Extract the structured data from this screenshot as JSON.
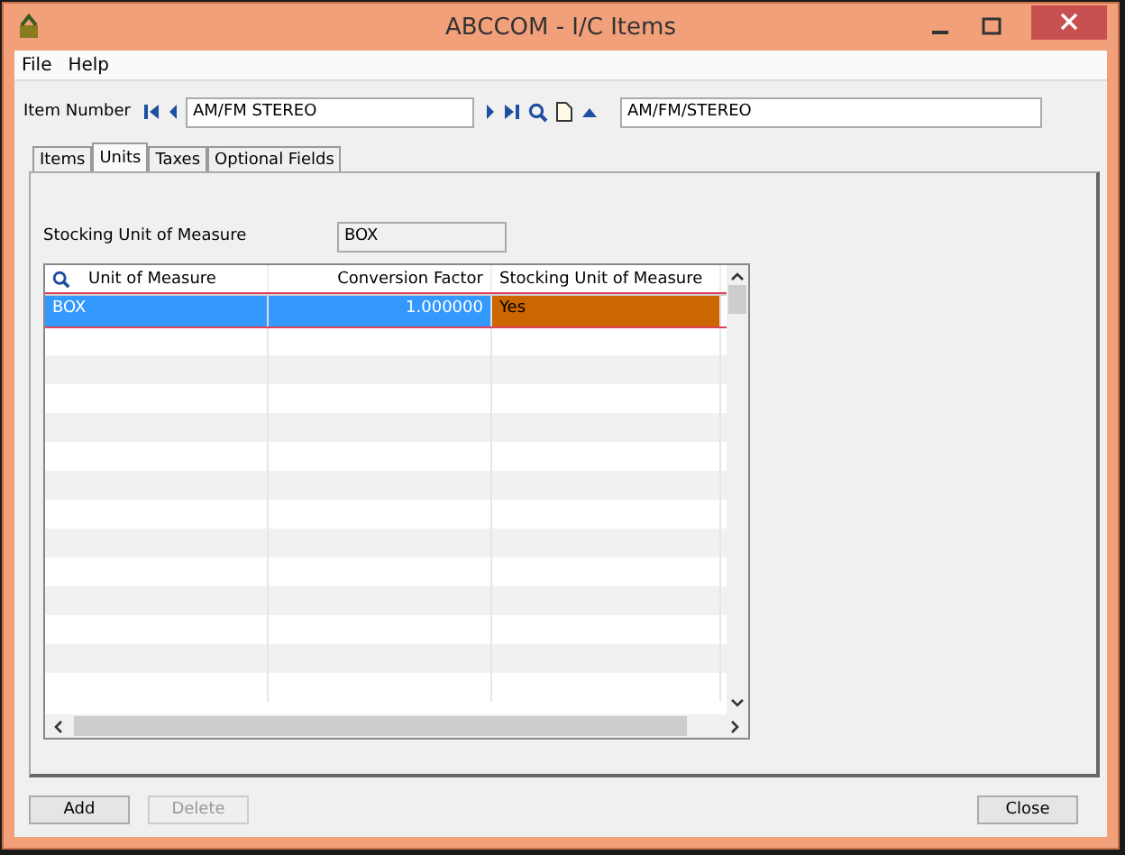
{
  "window": {
    "title": "ABCCOM - I/C Items"
  },
  "menu": [
    "File",
    "Help"
  ],
  "item_number": {
    "label": "Item Number",
    "value": "AM/FM STEREO",
    "description": "AM/FM/STEREO"
  },
  "tabs": [
    {
      "label": "Items",
      "selected": false
    },
    {
      "label": "Units",
      "selected": true
    },
    {
      "label": "Taxes",
      "selected": false
    },
    {
      "label": "Optional Fields",
      "selected": false
    }
  ],
  "stocking_unit": {
    "label": "Stocking Unit of Measure",
    "value": "BOX"
  },
  "table": {
    "columns": [
      "Unit of Measure",
      "Conversion Factor",
      "Stocking Unit of Measure"
    ],
    "rows": [
      {
        "cells": [
          "BOX",
          "1.000000",
          "Yes"
        ],
        "selected": true
      }
    ]
  },
  "buttons": [
    {
      "label": "Add",
      "disabled": false
    },
    {
      "label": "Delete",
      "disabled": true
    },
    {
      "label": "Close",
      "disabled": false
    }
  ]
}
